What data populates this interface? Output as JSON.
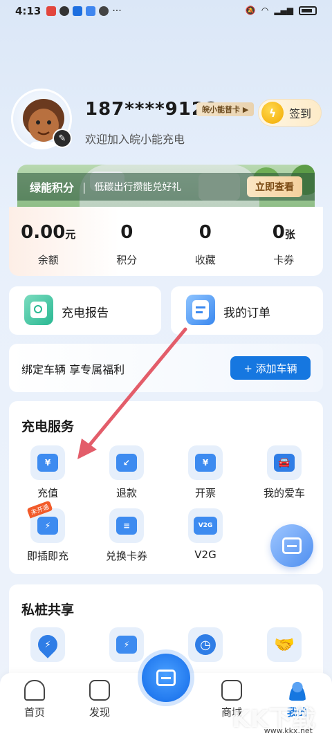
{
  "status_bar": {
    "time": "4:13"
  },
  "profile": {
    "phone": "187****9128",
    "member_tag": "皖小能普卡 ▶",
    "welcome": "欢迎加入皖小能充电",
    "checkin_label": "签到"
  },
  "banner": {
    "title": "绿能积分",
    "separator": "|",
    "subtitle": "低碳出行攒能兑好礼",
    "button": "立即查看"
  },
  "stats": [
    {
      "value": "0.00",
      "unit": "元",
      "label": "余额"
    },
    {
      "value": "0",
      "unit": "",
      "label": "积分"
    },
    {
      "value": "0",
      "unit": "",
      "label": "收藏"
    },
    {
      "value": "0",
      "unit": "张",
      "label": "卡券"
    }
  ],
  "quick_cards": {
    "report": "充电报告",
    "orders": "我的订单"
  },
  "bind_vehicle": {
    "text": "绑定车辆 享专属福利",
    "button": "+ 添加车辆"
  },
  "charging_service": {
    "title": "充电服务",
    "items": [
      {
        "label": "充值",
        "icon": "yuan-card-icon",
        "glyph": "¥"
      },
      {
        "label": "退款",
        "icon": "refund-card-icon",
        "glyph": "↙"
      },
      {
        "label": "开票",
        "icon": "invoice-icon",
        "glyph": "¥"
      },
      {
        "label": "我的爱车",
        "icon": "car-icon",
        "glyph": "🚘"
      },
      {
        "label": "即插即充",
        "icon": "plug-charge-icon",
        "glyph": "⚡",
        "tag": "未开通"
      },
      {
        "label": "兑换卡券",
        "icon": "coupon-icon",
        "glyph": "≡"
      },
      {
        "label": "V2G",
        "icon": "v2g-icon",
        "glyph": "V2G"
      }
    ]
  },
  "private_pile": {
    "title": "私桩共享",
    "items": [
      {
        "icon": "location-bolt-icon",
        "glyph": "⚡"
      },
      {
        "icon": "laptop-bolt-icon",
        "glyph": "⚡"
      },
      {
        "icon": "clock-icon",
        "glyph": "◷"
      },
      {
        "icon": "handshake-icon",
        "glyph": "🤝"
      }
    ]
  },
  "bottom_nav": [
    {
      "label": "首页"
    },
    {
      "label": "发现"
    },
    {
      "label": "商城"
    },
    {
      "label": "我的"
    }
  ],
  "watermark": {
    "logo": "KK下载",
    "url": "www.kkx.net"
  },
  "colors": {
    "accent": "#1677e0",
    "arrow": "#e35d6a"
  }
}
